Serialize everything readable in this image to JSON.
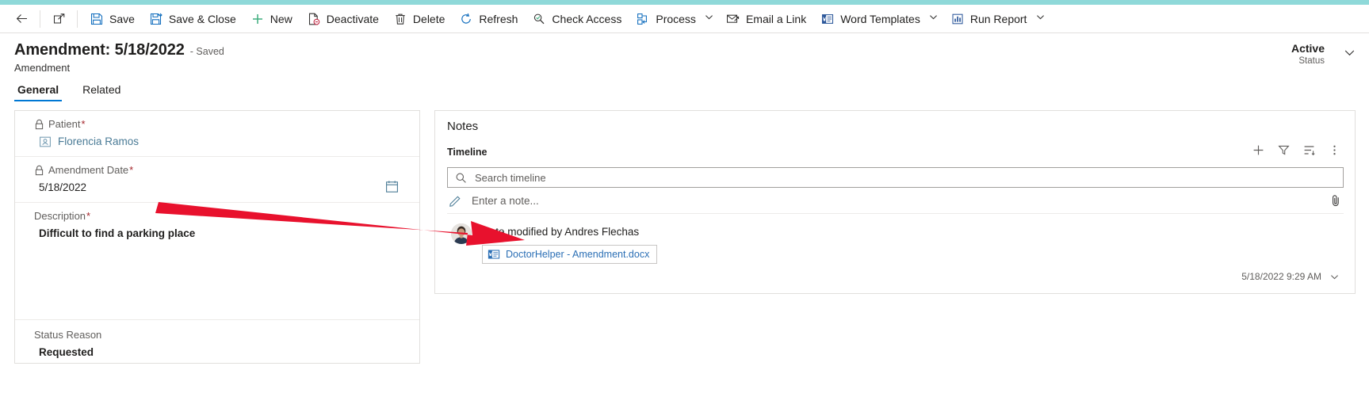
{
  "theme": {
    "accent_bar_color": "#8fd9d9",
    "tab_underline_color": "#0078d4",
    "required_star_color": "#a4262c",
    "link_color": "#2b6fb5",
    "annotation_arrow_color": "#e8112d"
  },
  "command_bar": {
    "back_icon": "back-arrow-icon",
    "popout_icon": "open-in-new-window-icon",
    "buttons": [
      {
        "label": "Save",
        "icon": "save-icon",
        "has_chevron": false
      },
      {
        "label": "Save & Close",
        "icon": "save-and-close-icon",
        "has_chevron": false
      },
      {
        "label": "New",
        "icon": "plus-icon",
        "has_chevron": false
      },
      {
        "label": "Deactivate",
        "icon": "deactivate-icon",
        "has_chevron": false
      },
      {
        "label": "Delete",
        "icon": "trash-icon",
        "has_chevron": false
      },
      {
        "label": "Refresh",
        "icon": "refresh-icon",
        "has_chevron": false
      },
      {
        "label": "Check Access",
        "icon": "check-access-icon",
        "has_chevron": false
      },
      {
        "label": "Process",
        "icon": "process-icon",
        "has_chevron": true
      },
      {
        "label": "Email a Link",
        "icon": "email-link-icon",
        "has_chevron": false
      },
      {
        "label": "Word Templates",
        "icon": "word-templates-icon",
        "has_chevron": true
      },
      {
        "label": "Run Report",
        "icon": "run-report-icon",
        "has_chevron": true
      }
    ]
  },
  "header": {
    "title": "Amendment: 5/18/2022",
    "saved_state": "- Saved",
    "subtitle": "Amendment",
    "status_value": "Active",
    "status_label": "Status",
    "status_chevron_icon": "chevron-down-icon"
  },
  "tabs": [
    {
      "label": "General",
      "active": true
    },
    {
      "label": "Related",
      "active": false
    }
  ],
  "form": {
    "fields": {
      "patient": {
        "label": "Patient",
        "required_marker": "*",
        "locked_icon": "lock-icon",
        "value": "Florencia Ramos",
        "value_icon": "contact-card-icon"
      },
      "amendment_date": {
        "label": "Amendment Date",
        "required_marker": "*",
        "locked_icon": "lock-icon",
        "value": "5/18/2022",
        "calendar_icon": "calendar-icon"
      },
      "description": {
        "label": "Description",
        "required_marker": "*",
        "value": "Difficult to find a parking place"
      },
      "status_reason": {
        "label": "Status Reason",
        "required_marker": "",
        "value": "Requested"
      }
    }
  },
  "notes_panel": {
    "title": "Notes",
    "timeline_label": "Timeline",
    "actions": [
      {
        "name": "add-record-button",
        "icon": "plus-icon"
      },
      {
        "name": "filter-button",
        "icon": "filter-icon"
      },
      {
        "name": "sort-button",
        "icon": "sort-icon"
      },
      {
        "name": "more-options-button",
        "icon": "more-vertical-icon"
      }
    ],
    "search": {
      "placeholder": "Search timeline",
      "value": "",
      "icon": "search-icon"
    },
    "note_entry": {
      "placeholder": "Enter a note...",
      "pencil_icon": "pencil-icon",
      "attach_icon": "paperclip-icon"
    },
    "timeline_items": [
      {
        "headline": "Note modified by Andres Flechas",
        "avatar": "user-avatar",
        "attachment": {
          "name": "DoctorHelper - Amendment.docx",
          "icon": "word-document-icon"
        },
        "timestamp": "5/18/2022 9:29 AM",
        "expand_icon": "chevron-down-icon"
      }
    ]
  }
}
